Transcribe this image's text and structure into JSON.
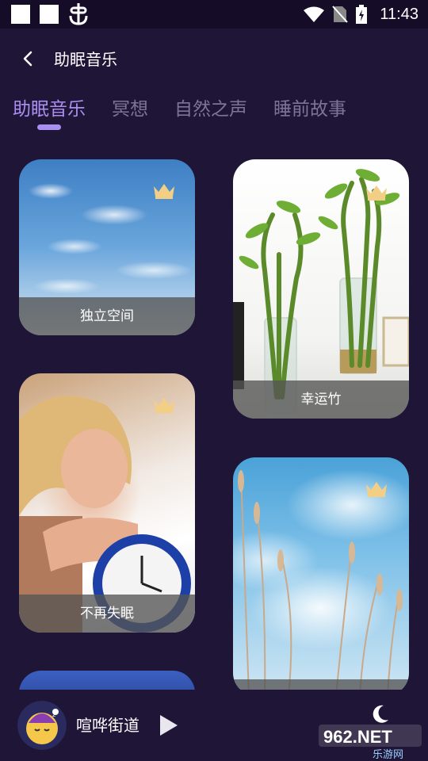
{
  "status_bar": {
    "time": "11:43",
    "icons": [
      "square-icon",
      "square-icon",
      "bug-icon",
      "wifi-icon",
      "no-sim-icon",
      "battery-charging-icon"
    ]
  },
  "header": {
    "back_icon": "chevron-left-icon",
    "title": "助眠音乐"
  },
  "tabs": [
    {
      "label": "助眠音乐",
      "active": true
    },
    {
      "label": "冥想",
      "active": false
    },
    {
      "label": "自然之声",
      "active": false
    },
    {
      "label": "睡前故事",
      "active": false
    }
  ],
  "cards": [
    {
      "caption": "独立空间",
      "premium": true,
      "image": "blue-sky-clouds"
    },
    {
      "caption": "幸运竹",
      "premium": true,
      "image": "lucky-bamboo-vases"
    },
    {
      "caption": "不再失眠",
      "premium": true,
      "image": "woman-alarm-clock"
    },
    {
      "caption": "",
      "premium": true,
      "image": "reeds-sky"
    },
    {
      "caption": "",
      "premium": false,
      "image": "night-sky-partial"
    }
  ],
  "player": {
    "title": "喧哗街道",
    "play_icon": "play-icon",
    "moon_icon": "moon-icon"
  },
  "watermark": {
    "brand": "962.NET",
    "sub": "乐游网"
  },
  "colors": {
    "background": "#1f1536",
    "status_bar": "#150d28",
    "tab_active": "#a98ff0",
    "tab_inactive": "#7c7598",
    "crown": "#f3cf86"
  }
}
